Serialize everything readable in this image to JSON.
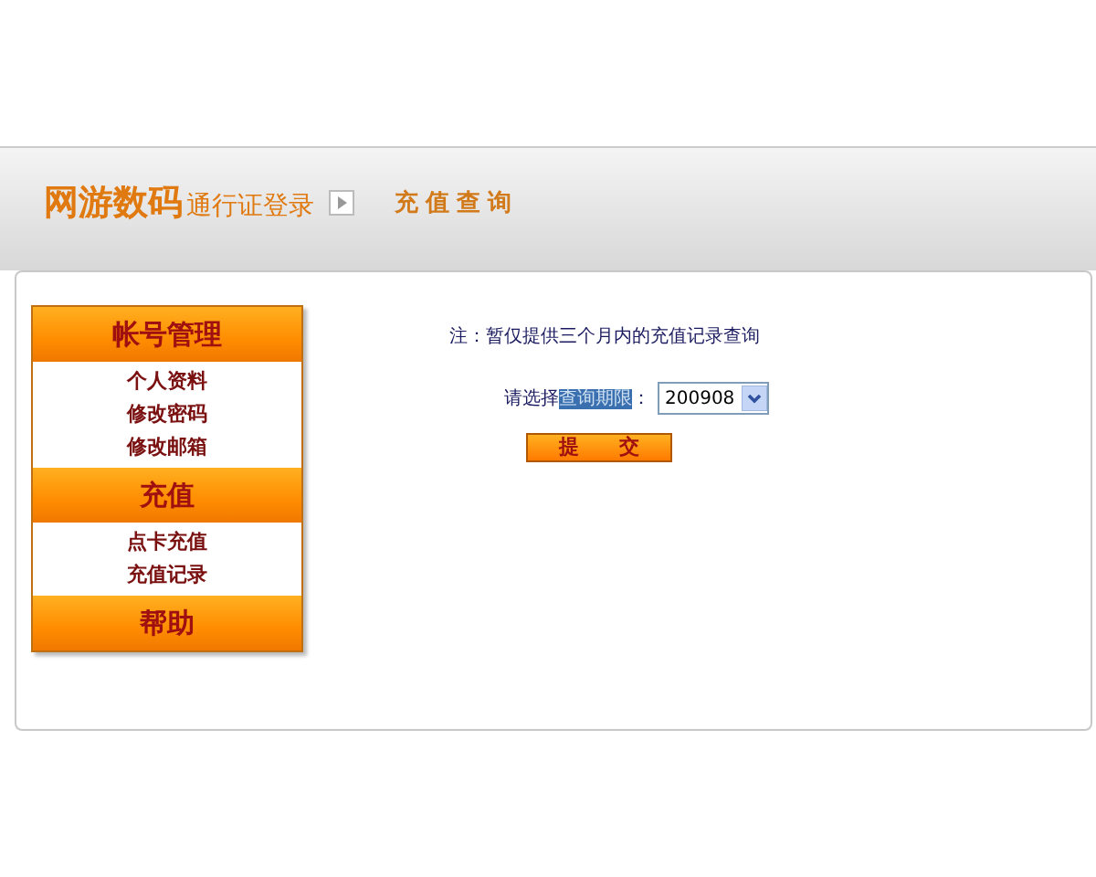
{
  "header": {
    "brand": "网游数码",
    "subtitle": "通行证登录",
    "page_title": "充值查询"
  },
  "sidebar": [
    {
      "title": "帐号管理",
      "items": [
        {
          "label": "个人资料"
        },
        {
          "label": "修改密码"
        },
        {
          "label": "修改邮箱"
        }
      ]
    },
    {
      "title": "充值",
      "items": [
        {
          "label": "点卡充值"
        },
        {
          "label": "充值记录"
        }
      ]
    },
    {
      "title": "帮助"
    }
  ],
  "note": "注：暂仅提供三个月内的充值记录查询",
  "period": {
    "label_before": "请选择",
    "label_highlighted": "查询期限",
    "label_after": "：",
    "value": "200908"
  },
  "submit": "提　　交"
}
